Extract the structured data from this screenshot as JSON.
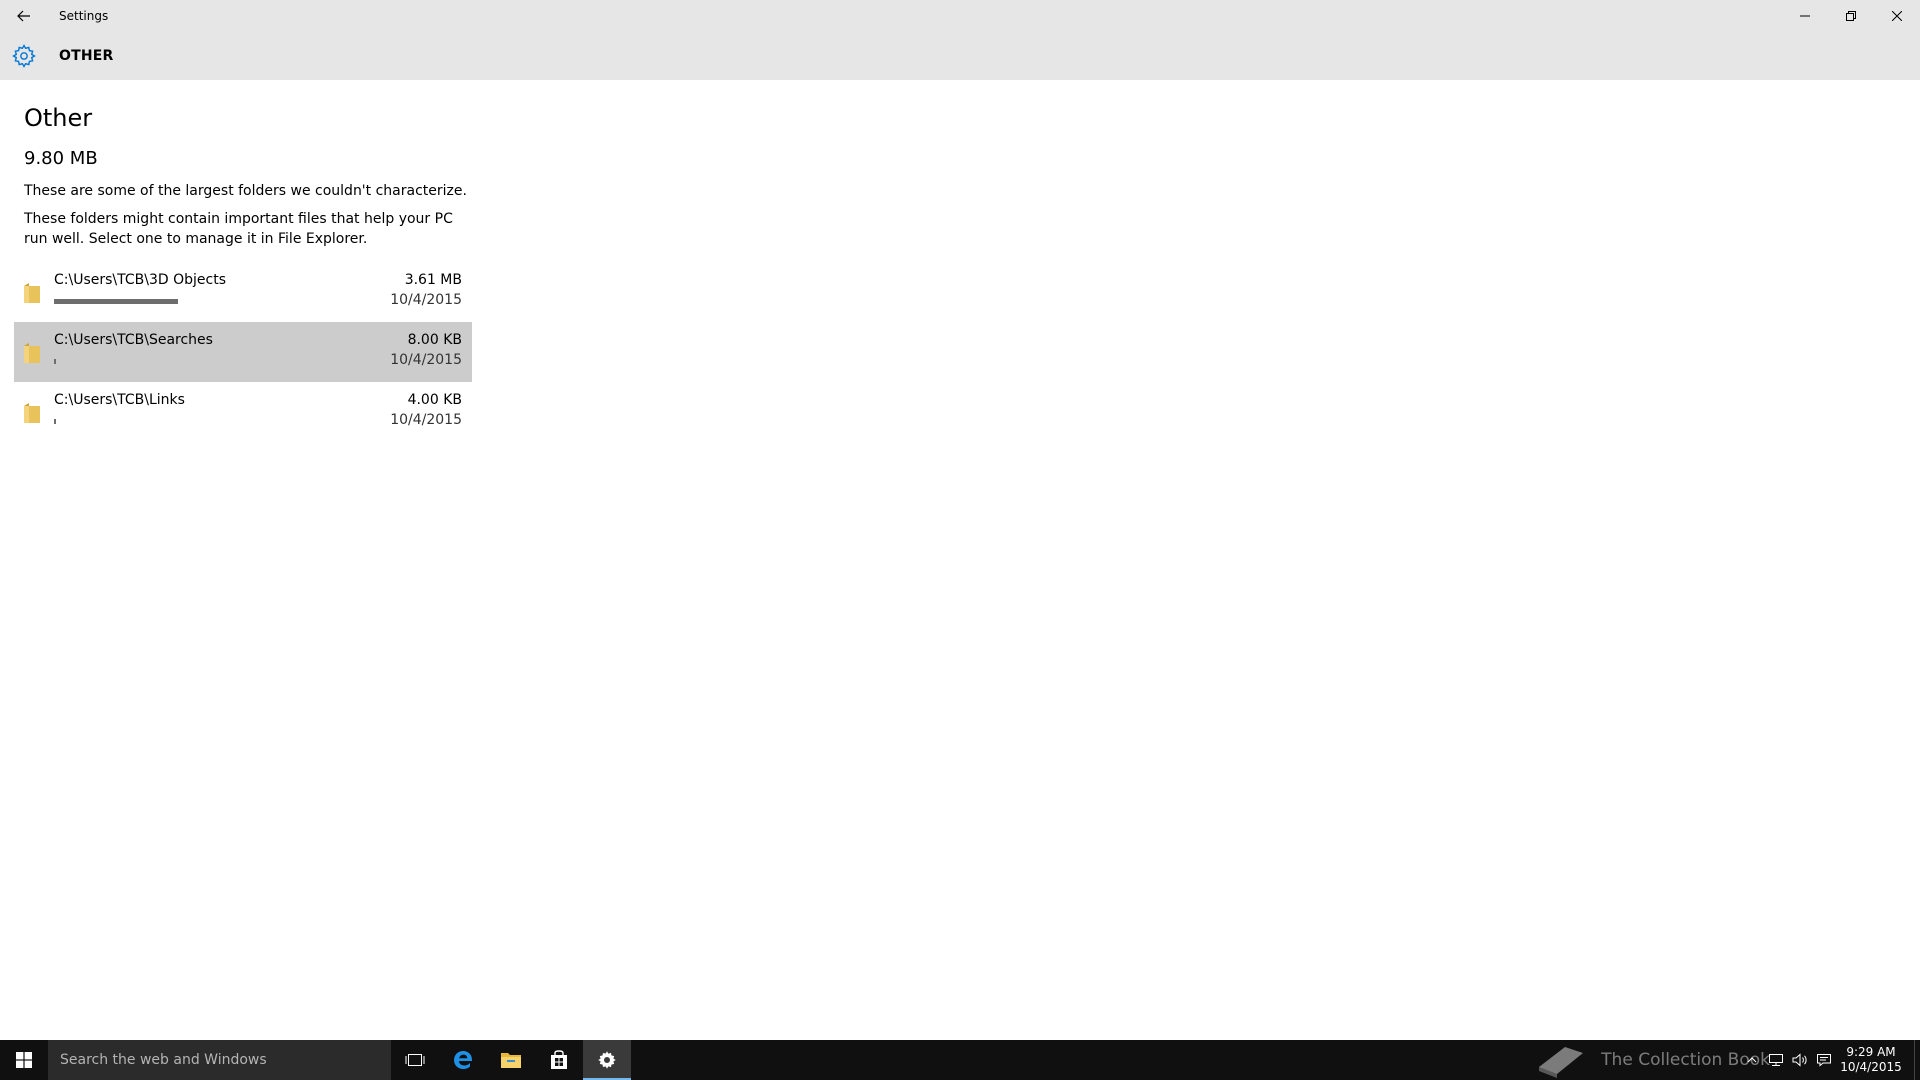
{
  "window": {
    "title": "Settings"
  },
  "header": {
    "title": "OTHER"
  },
  "page": {
    "title": "Other",
    "total_size": "9.80 MB",
    "description1": "These are some of the largest folders we couldn't characterize.",
    "description2": "These folders might contain important files that help your PC run well. Select one to manage it in File Explorer."
  },
  "folders": [
    {
      "path": "C:\\Users\\TCB\\3D Objects",
      "size": "3.61 MB",
      "date": "10/4/2015",
      "usage_fraction": 0.69,
      "selected": false
    },
    {
      "path": "C:\\Users\\TCB\\Searches",
      "size": "8.00 KB",
      "date": "10/4/2015",
      "usage_fraction": 0.01,
      "selected": true
    },
    {
      "path": "C:\\Users\\TCB\\Links",
      "size": "4.00 KB",
      "date": "10/4/2015",
      "usage_fraction": 0.01,
      "selected": false
    }
  ],
  "taskbar": {
    "search_placeholder": "Search the web and Windows",
    "watermark": "The Collection Book",
    "time": "9:29 AM",
    "date": "10/4/2015"
  },
  "colors": {
    "accent": "#0078d7",
    "folder": "#e8c25a",
    "titlebar": "#e6e6e6",
    "selected_row": "#cccccc",
    "taskbar": "#101010"
  }
}
